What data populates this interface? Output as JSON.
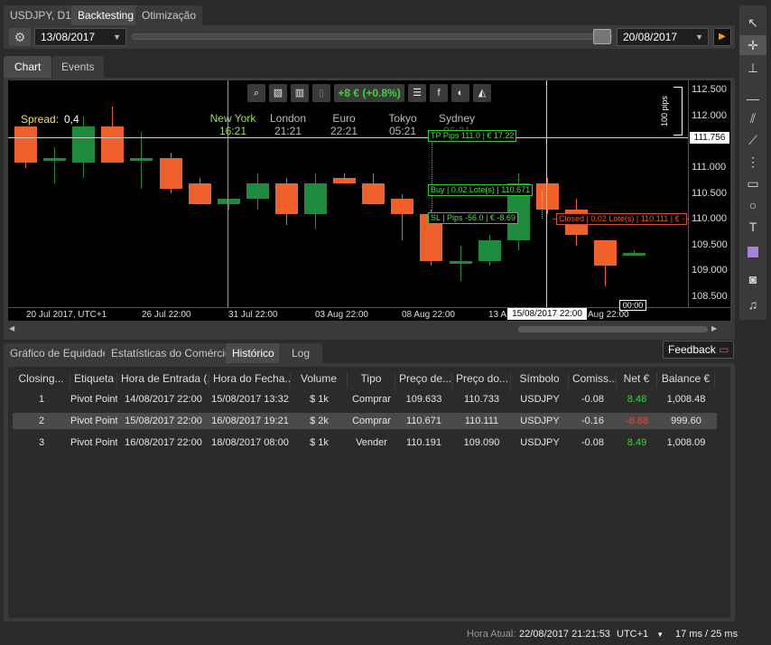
{
  "top_tabs": [
    {
      "label": "USDJPY, D1",
      "active": false
    },
    {
      "label": "Backtesting",
      "active": true
    },
    {
      "label": "Otimização",
      "active": false
    }
  ],
  "period": {
    "start": "13/08/2017",
    "end": "20/08/2017"
  },
  "chart_tabs": [
    {
      "label": "Chart",
      "active": true
    },
    {
      "label": "Events",
      "active": false
    }
  ],
  "chart_toolbar": {
    "pnl": "+8 € (+0.8%)"
  },
  "spread": {
    "label": "Spread:",
    "value": "0,4"
  },
  "sessions": [
    {
      "name": "New York",
      "time": "16:21",
      "active": true
    },
    {
      "name": "London",
      "time": "21:21",
      "active": false
    },
    {
      "name": "Euro",
      "time": "22:21",
      "active": false
    },
    {
      "name": "Tokyo",
      "time": "05:21",
      "active": false
    },
    {
      "name": "Sydney",
      "time": "06:21",
      "active": false
    }
  ],
  "pips_label": "100 pips",
  "crosshair_price": "111.756",
  "crosshair_date": "15/08/2017 22:00",
  "countdown": "00:00",
  "orders": {
    "tp": {
      "tag": "TP",
      "pips": "Pips 111.0",
      "money": "€ 17.22"
    },
    "buy": {
      "tag": "Buy",
      "lots": "0.02 Lote(s)",
      "price": "110.671"
    },
    "sl": {
      "tag": "SL",
      "pips": "Pips -56.0",
      "money": "€ -8.69"
    },
    "closed": {
      "tag": "Closed",
      "lots": "0.02 Lote(s)",
      "price": "110.111",
      "money": "€ -"
    }
  },
  "chart_data": {
    "type": "candlestick",
    "x_ticks": [
      "20 Jul 2017, UTC+1",
      "26 Jul 22:00",
      "31 Jul 22:00",
      "03 Aug 22:00",
      "08 Aug 22:00",
      "13 A",
      "Aug 22:00"
    ],
    "y_ticks": [
      "112.500",
      "112.000",
      "111.500",
      "111.000",
      "110.500",
      "110.000",
      "109.500",
      "109.000",
      "108.500"
    ],
    "ylim": [
      108.3,
      112.7
    ],
    "candles": [
      {
        "o": 111.8,
        "h": 111.8,
        "l": 111.0,
        "c": 111.1
      },
      {
        "o": 111.2,
        "h": 111.4,
        "l": 110.7,
        "c": 111.2
      },
      {
        "o": 111.1,
        "h": 112.0,
        "l": 110.8,
        "c": 111.8
      },
      {
        "o": 111.8,
        "h": 112.2,
        "l": 111.1,
        "c": 111.1
      },
      {
        "o": 111.2,
        "h": 111.7,
        "l": 110.6,
        "c": 111.2
      },
      {
        "o": 111.2,
        "h": 111.3,
        "l": 110.5,
        "c": 110.6
      },
      {
        "o": 110.7,
        "h": 110.8,
        "l": 110.3,
        "c": 110.3
      },
      {
        "o": 110.3,
        "h": 110.4,
        "l": 110.2,
        "c": 110.4
      },
      {
        "o": 110.4,
        "h": 110.9,
        "l": 110.2,
        "c": 110.7
      },
      {
        "o": 110.7,
        "h": 110.8,
        "l": 109.9,
        "c": 110.1
      },
      {
        "o": 110.1,
        "h": 110.9,
        "l": 109.8,
        "c": 110.7
      },
      {
        "o": 110.8,
        "h": 110.9,
        "l": 110.7,
        "c": 110.7
      },
      {
        "o": 110.7,
        "h": 110.9,
        "l": 110.3,
        "c": 110.3
      },
      {
        "o": 110.4,
        "h": 110.5,
        "l": 109.6,
        "c": 110.1
      },
      {
        "o": 110.1,
        "h": 110.2,
        "l": 109.1,
        "c": 109.2
      },
      {
        "o": 109.2,
        "h": 109.5,
        "l": 108.8,
        "c": 109.2
      },
      {
        "o": 109.2,
        "h": 109.7,
        "l": 109.1,
        "c": 109.6
      },
      {
        "o": 109.6,
        "h": 110.9,
        "l": 109.4,
        "c": 110.7
      },
      {
        "o": 110.7,
        "h": 110.8,
        "l": 110.1,
        "c": 110.2
      },
      {
        "o": 110.2,
        "h": 110.4,
        "l": 109.5,
        "c": 109.7
      },
      {
        "o": 109.6,
        "h": 109.6,
        "l": 108.7,
        "c": 109.1
      },
      {
        "o": 109.3,
        "h": 109.4,
        "l": 109.3,
        "c": 109.35
      }
    ]
  },
  "bottom_tabs": [
    {
      "label": "Gráfico de Equidade",
      "active": false
    },
    {
      "label": "Estatísticas do Comércio",
      "active": false
    },
    {
      "label": "Histórico",
      "active": true
    },
    {
      "label": "Log",
      "active": false
    }
  ],
  "feedback": "Feedback",
  "table": {
    "headers": [
      "Closing...",
      "Etiqueta",
      "Hora de Entrada (...",
      "Hora do Fecha...",
      "Volume",
      "Tipo",
      "Preço de...",
      "Preço do...",
      "Símbolo",
      "Comiss...",
      "Net €",
      "Balance €"
    ],
    "rows": [
      [
        "1",
        "Pivot Points",
        "14/08/2017 22:00",
        "15/08/2017 13:32",
        "$ 1k",
        "Comprar",
        "109.633",
        "110.733",
        "USDJPY",
        "-0.08",
        "8.48",
        "1,008.48"
      ],
      [
        "2",
        "Pivot Points",
        "15/08/2017 22:00",
        "16/08/2017 19:21",
        "$ 2k",
        "Comprar",
        "110.671",
        "110.111",
        "USDJPY",
        "-0.16",
        "-8.88",
        "999.60"
      ],
      [
        "3",
        "Pivot Points",
        "16/08/2017 22:00",
        "18/08/2017 08:00",
        "$ 1k",
        "Vender",
        "110.191",
        "109.090",
        "USDJPY",
        "-0.08",
        "8.49",
        "1,008.09"
      ]
    ]
  },
  "status": {
    "label": "Hora Atual:",
    "time": "22/08/2017 21:21:53",
    "tz": "UTC+1",
    "latency": "17 ms / 25 ms"
  },
  "colors": {
    "bull": "#1e8a3c",
    "bear": "#f0602a",
    "positive": "#3fd13f",
    "negative": "#e8472a"
  }
}
